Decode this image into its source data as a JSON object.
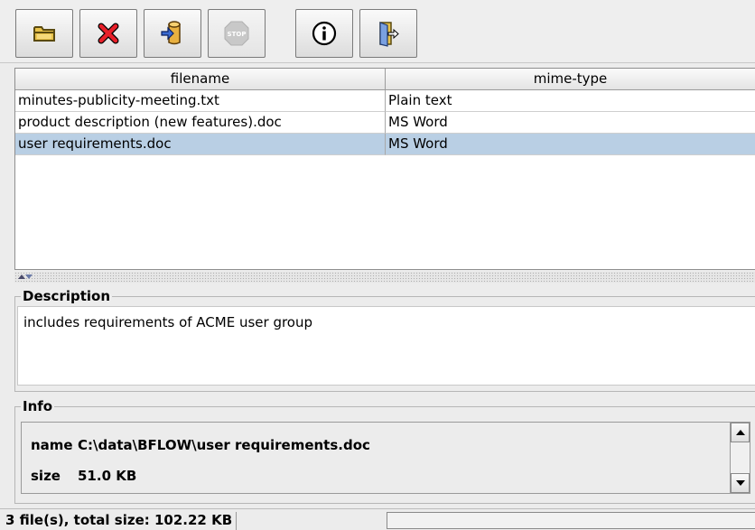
{
  "toolbar": {
    "buttons": [
      {
        "name": "open-folder-button",
        "icon": "folder-icon",
        "enabled": true
      },
      {
        "name": "remove-button",
        "icon": "red-x-icon",
        "enabled": true
      },
      {
        "name": "export-button",
        "icon": "database-export-icon",
        "enabled": true
      },
      {
        "name": "stop-button",
        "icon": "stop-icon",
        "label": "STOP",
        "enabled": false
      },
      {
        "name": "info-button",
        "icon": "info-icon",
        "enabled": true
      },
      {
        "name": "exit-button",
        "icon": "exit-door-icon",
        "enabled": true
      }
    ]
  },
  "table": {
    "columns": [
      "filename",
      "mime-type"
    ],
    "rows": [
      {
        "filename": "minutes-publicity-meeting.txt",
        "mime": "Plain text",
        "selected": false
      },
      {
        "filename": "product description (new features).doc",
        "mime": "MS Word",
        "selected": false
      },
      {
        "filename": "user requirements.doc",
        "mime": "MS Word",
        "selected": true
      }
    ],
    "selection_color": "#b9cfe4"
  },
  "description": {
    "title": "Description",
    "text": "includes requirements of ACME user group"
  },
  "info": {
    "title": "Info",
    "name_key": "name",
    "name_value": "C:\\data\\BFLOW\\user requirements.doc",
    "size_key": "size",
    "size_value": "51.0 KB"
  },
  "status": {
    "text": "3 file(s), total size: 102.22 KB"
  }
}
